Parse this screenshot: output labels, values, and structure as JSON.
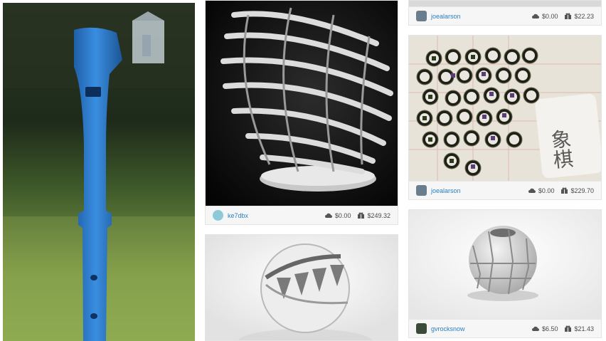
{
  "cards": [
    {
      "id": "vase",
      "username": "ke7dbx",
      "price": "$0.00",
      "value": "$249.32"
    },
    {
      "id": "top-right",
      "username": "joealarson",
      "price": "$0.00",
      "value": "$22.23"
    },
    {
      "id": "xiangqi",
      "username": "joealarson",
      "price": "$0.00",
      "value": "$229.70"
    },
    {
      "id": "sphere",
      "username": "gvrocksnow",
      "price": "$6.50",
      "value": "$21.43"
    }
  ],
  "xiangqi_label": "象棋",
  "icons": {
    "price": "cloud-download-icon",
    "value": "gift-icon"
  }
}
